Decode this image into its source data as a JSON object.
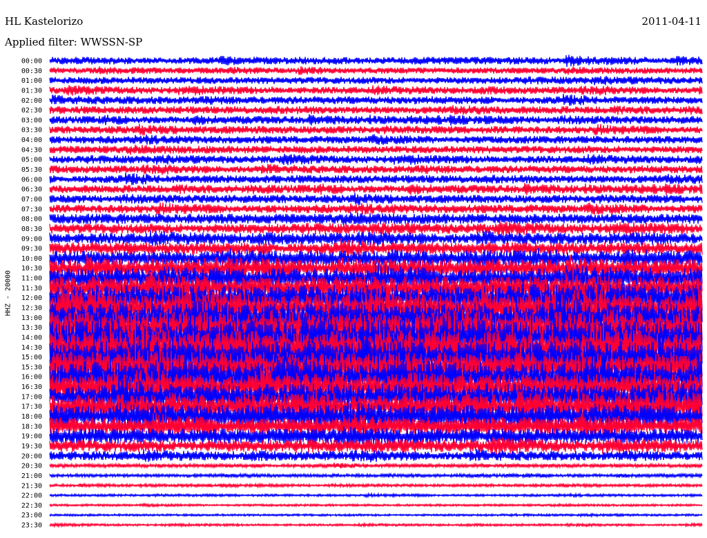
{
  "header": {
    "station": "HL Kastelorizo",
    "date": "2011-04-11",
    "filter": "Applied filter: WWSSN-SP"
  },
  "colors": {
    "trace_a": "#0000ff",
    "trace_b": "#ff0033",
    "background": "#ffffff",
    "text": "#000000"
  },
  "chart_data": {
    "type": "line",
    "title": "HL Kastelorizo",
    "ylabel": "HHZ - 20000",
    "grid": false,
    "x_minutes_per_row": 30,
    "row_labels": [
      "00:00",
      "00:30",
      "01:00",
      "01:30",
      "02:00",
      "02:30",
      "03:00",
      "03:30",
      "04:00",
      "04:30",
      "05:00",
      "05:30",
      "06:00",
      "06:30",
      "07:00",
      "07:30",
      "08:00",
      "08:30",
      "09:00",
      "09:30",
      "10:00",
      "10:30",
      "11:00",
      "11:30",
      "12:00",
      "12:30",
      "13:00",
      "13:30",
      "14:00",
      "14:30",
      "15:00",
      "15:30",
      "16:00",
      "16:30",
      "17:00",
      "17:30",
      "18:00",
      "18:30",
      "19:00",
      "19:30",
      "20:00",
      "20:30",
      "21:00",
      "21:30",
      "22:00",
      "22:30",
      "23:00",
      "23:30"
    ],
    "row_colors": [
      "blue",
      "red"
    ],
    "relative_amplitude": [
      0.75,
      0.6,
      0.7,
      0.7,
      0.75,
      0.75,
      0.75,
      0.75,
      0.75,
      0.75,
      0.75,
      0.75,
      0.8,
      0.8,
      0.8,
      0.85,
      1.0,
      1.0,
      1.1,
      1.2,
      1.5,
      1.7,
      2.0,
      2.3,
      2.6,
      2.8,
      3.0,
      3.1,
      3.2,
      3.2,
      3.2,
      3.0,
      2.8,
      2.6,
      2.5,
      2.4,
      2.2,
      1.8,
      1.5,
      1.2,
      0.9,
      0.35,
      0.3,
      0.25,
      0.22,
      0.2,
      0.2,
      0.2
    ]
  }
}
